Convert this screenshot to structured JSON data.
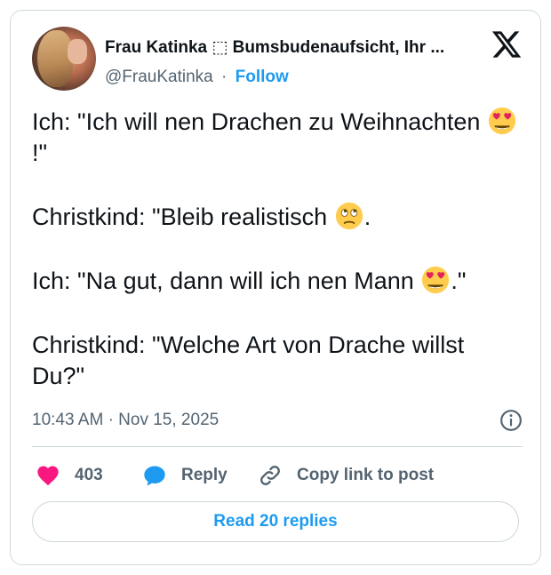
{
  "author": {
    "display_name": "Frau Katinka ⬚ Bumsbudenaufsicht, Ihr ...",
    "handle": "@FrauKatinka",
    "separator": "·",
    "follow_label": "Follow"
  },
  "tweet": {
    "lines": [
      {
        "text_before": "Ich: \"Ich will nen Drachen zu Weihnachten ",
        "emoji": "heart-eyes",
        "text_after": "!\""
      },
      {
        "text_before": "Christkind: \"Bleib realistisch ",
        "emoji": "eye-roll",
        "text_after": "."
      },
      {
        "text_before": "Ich: \"Na gut, dann will ich nen Mann ",
        "emoji": "heart-eyes",
        "text_after": ".\""
      },
      {
        "text_before": "Christkind: \"Welche Art von Drache willst Du?\"",
        "emoji": "",
        "text_after": ""
      }
    ]
  },
  "meta": {
    "time": "10:43 AM",
    "separator": "·",
    "date": "Nov 15, 2025"
  },
  "actions": {
    "like_count": "403",
    "reply_label": "Reply",
    "copy_label": "Copy link to post"
  },
  "read_replies_label": "Read 20 replies",
  "icons": [
    "x-logo-icon",
    "info-icon",
    "heart-icon",
    "reply-bubble-icon",
    "link-icon"
  ],
  "colors": {
    "accent": "#1d9bf0",
    "like": "#f91880",
    "text": "#0f1419",
    "secondary": "#536471",
    "border": "#cfd9de"
  }
}
